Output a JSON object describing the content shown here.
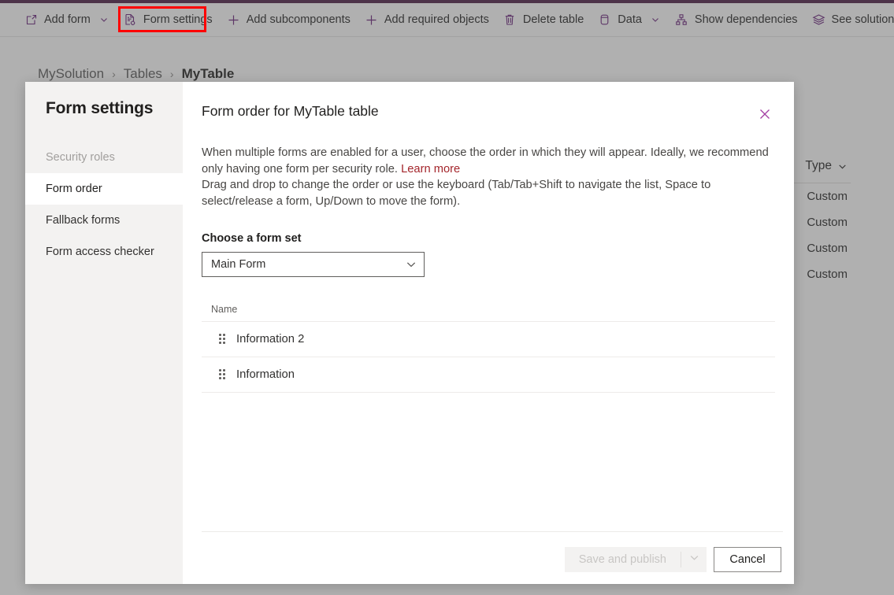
{
  "theme": {
    "accent_purple": "#68217a",
    "top_bar": "#4b1c44",
    "link_red": "#a4262c",
    "highlight_box": "#ff0000",
    "nav_selected_bg": "#ffffff",
    "nav_bg": "#f3f2f1"
  },
  "command_bar": {
    "items": [
      {
        "label": "Add form",
        "icon": "add-form-icon",
        "has_chevron": true
      },
      {
        "label": "Form settings",
        "icon": "form-settings-icon",
        "has_chevron": false
      },
      {
        "label": "Add subcomponents",
        "icon": "plus-icon",
        "has_chevron": false
      },
      {
        "label": "Add required objects",
        "icon": "plus-icon",
        "has_chevron": false
      },
      {
        "label": "Delete table",
        "icon": "trash-icon",
        "has_chevron": false
      },
      {
        "label": "Data",
        "icon": "database-icon",
        "has_chevron": true
      },
      {
        "label": "Show dependencies",
        "icon": "dependencies-icon",
        "has_chevron": false
      },
      {
        "label": "See solution layers",
        "icon": "layers-icon",
        "has_chevron": false
      }
    ],
    "highlighted_item": "Form settings"
  },
  "breadcrumb": {
    "items": [
      {
        "label": "MySolution",
        "current": false
      },
      {
        "label": "Tables",
        "current": false
      },
      {
        "label": "MyTable",
        "current": true
      }
    ],
    "separator": "›"
  },
  "background_table": {
    "columns": [
      {
        "label": "Type",
        "has_sort_chevron": true
      }
    ],
    "rows": [
      {
        "type": "Custom"
      },
      {
        "type": "Custom"
      },
      {
        "type": "Custom"
      },
      {
        "type": "Custom"
      }
    ]
  },
  "dialog": {
    "nav": {
      "title": "Form settings",
      "items": [
        {
          "label": "Security roles",
          "state": "disabled"
        },
        {
          "label": "Form order",
          "state": "selected"
        },
        {
          "label": "Fallback forms",
          "state": "normal"
        },
        {
          "label": "Form access checker",
          "state": "normal"
        }
      ]
    },
    "title": "Form order for MyTable table",
    "close_label": "Close",
    "description": {
      "paragraph_1_before_link": "When multiple forms are enabled for a user, choose the order in which they will appear. Ideally, we recommend only having one form per security role. ",
      "link_text": "Learn more",
      "paragraph_2": "Drag and drop to change the order or use the keyboard (Tab/Tab+Shift to navigate the list, Space to select/release a form, Up/Down to move the form)."
    },
    "form_set": {
      "label": "Choose a form set",
      "selected": "Main Form",
      "options": [
        "Main Form"
      ]
    },
    "list": {
      "columns": [
        "Name"
      ],
      "rows": [
        {
          "name": "Information 2"
        },
        {
          "name": "Information"
        }
      ]
    },
    "footer": {
      "primary_label": "Save and publish",
      "primary_disabled": true,
      "primary_has_split_menu": true,
      "secondary_label": "Cancel"
    }
  }
}
